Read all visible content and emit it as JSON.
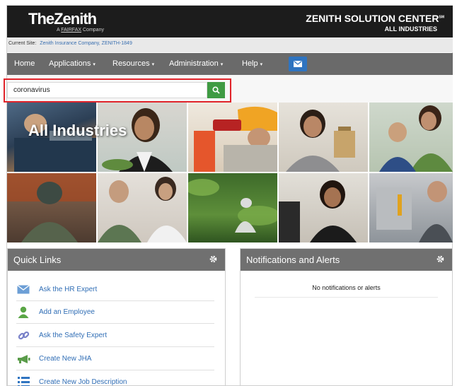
{
  "header": {
    "logo_text": "TheZenith",
    "logo_sub_prefix": "A",
    "logo_sub_brand": "FAIRFAX",
    "logo_sub_suffix": "Company",
    "title": "ZENITH SOLUTION CENTER",
    "title_mark": "SM",
    "subtitle": "ALL INDUSTRIES"
  },
  "site_bar": {
    "label": "Current Site:",
    "value": "Zenith Insurance Company, ZENITH-1849"
  },
  "nav": {
    "items": [
      {
        "label": "Home",
        "has_caret": false
      },
      {
        "label": "Applications",
        "has_caret": true
      },
      {
        "label": "Resources",
        "has_caret": true
      },
      {
        "label": "Administration",
        "has_caret": true
      },
      {
        "label": "Help",
        "has_caret": true
      }
    ],
    "caret": "▾",
    "mail_icon": "envelope-icon"
  },
  "search": {
    "value": "coronavirus",
    "button_icon": "search-icon"
  },
  "hero": {
    "title": "All Industries"
  },
  "quick_links": {
    "title": "Quick Links",
    "items": [
      {
        "label": "Ask the HR Expert",
        "icon": "envelope-icon"
      },
      {
        "label": "Add an Employee",
        "icon": "person-icon"
      },
      {
        "label": "Ask the Safety Expert",
        "icon": "link-icon"
      },
      {
        "label": "Create New JHA",
        "icon": "megaphone-icon"
      },
      {
        "label": "Create New Job Description",
        "icon": "list-icon"
      }
    ]
  },
  "notifications": {
    "title": "Notifications and Alerts",
    "empty_message": "No notifications or alerts"
  },
  "colors": {
    "header_bg": "#1c1c1c",
    "nav_bg": "#6a6a6a",
    "panel_head_bg": "#707070",
    "link_blue": "#2f6db5",
    "search_green": "#3f9b43",
    "highlight_red": "#e0232a",
    "mail_blue": "#2f74c0"
  }
}
